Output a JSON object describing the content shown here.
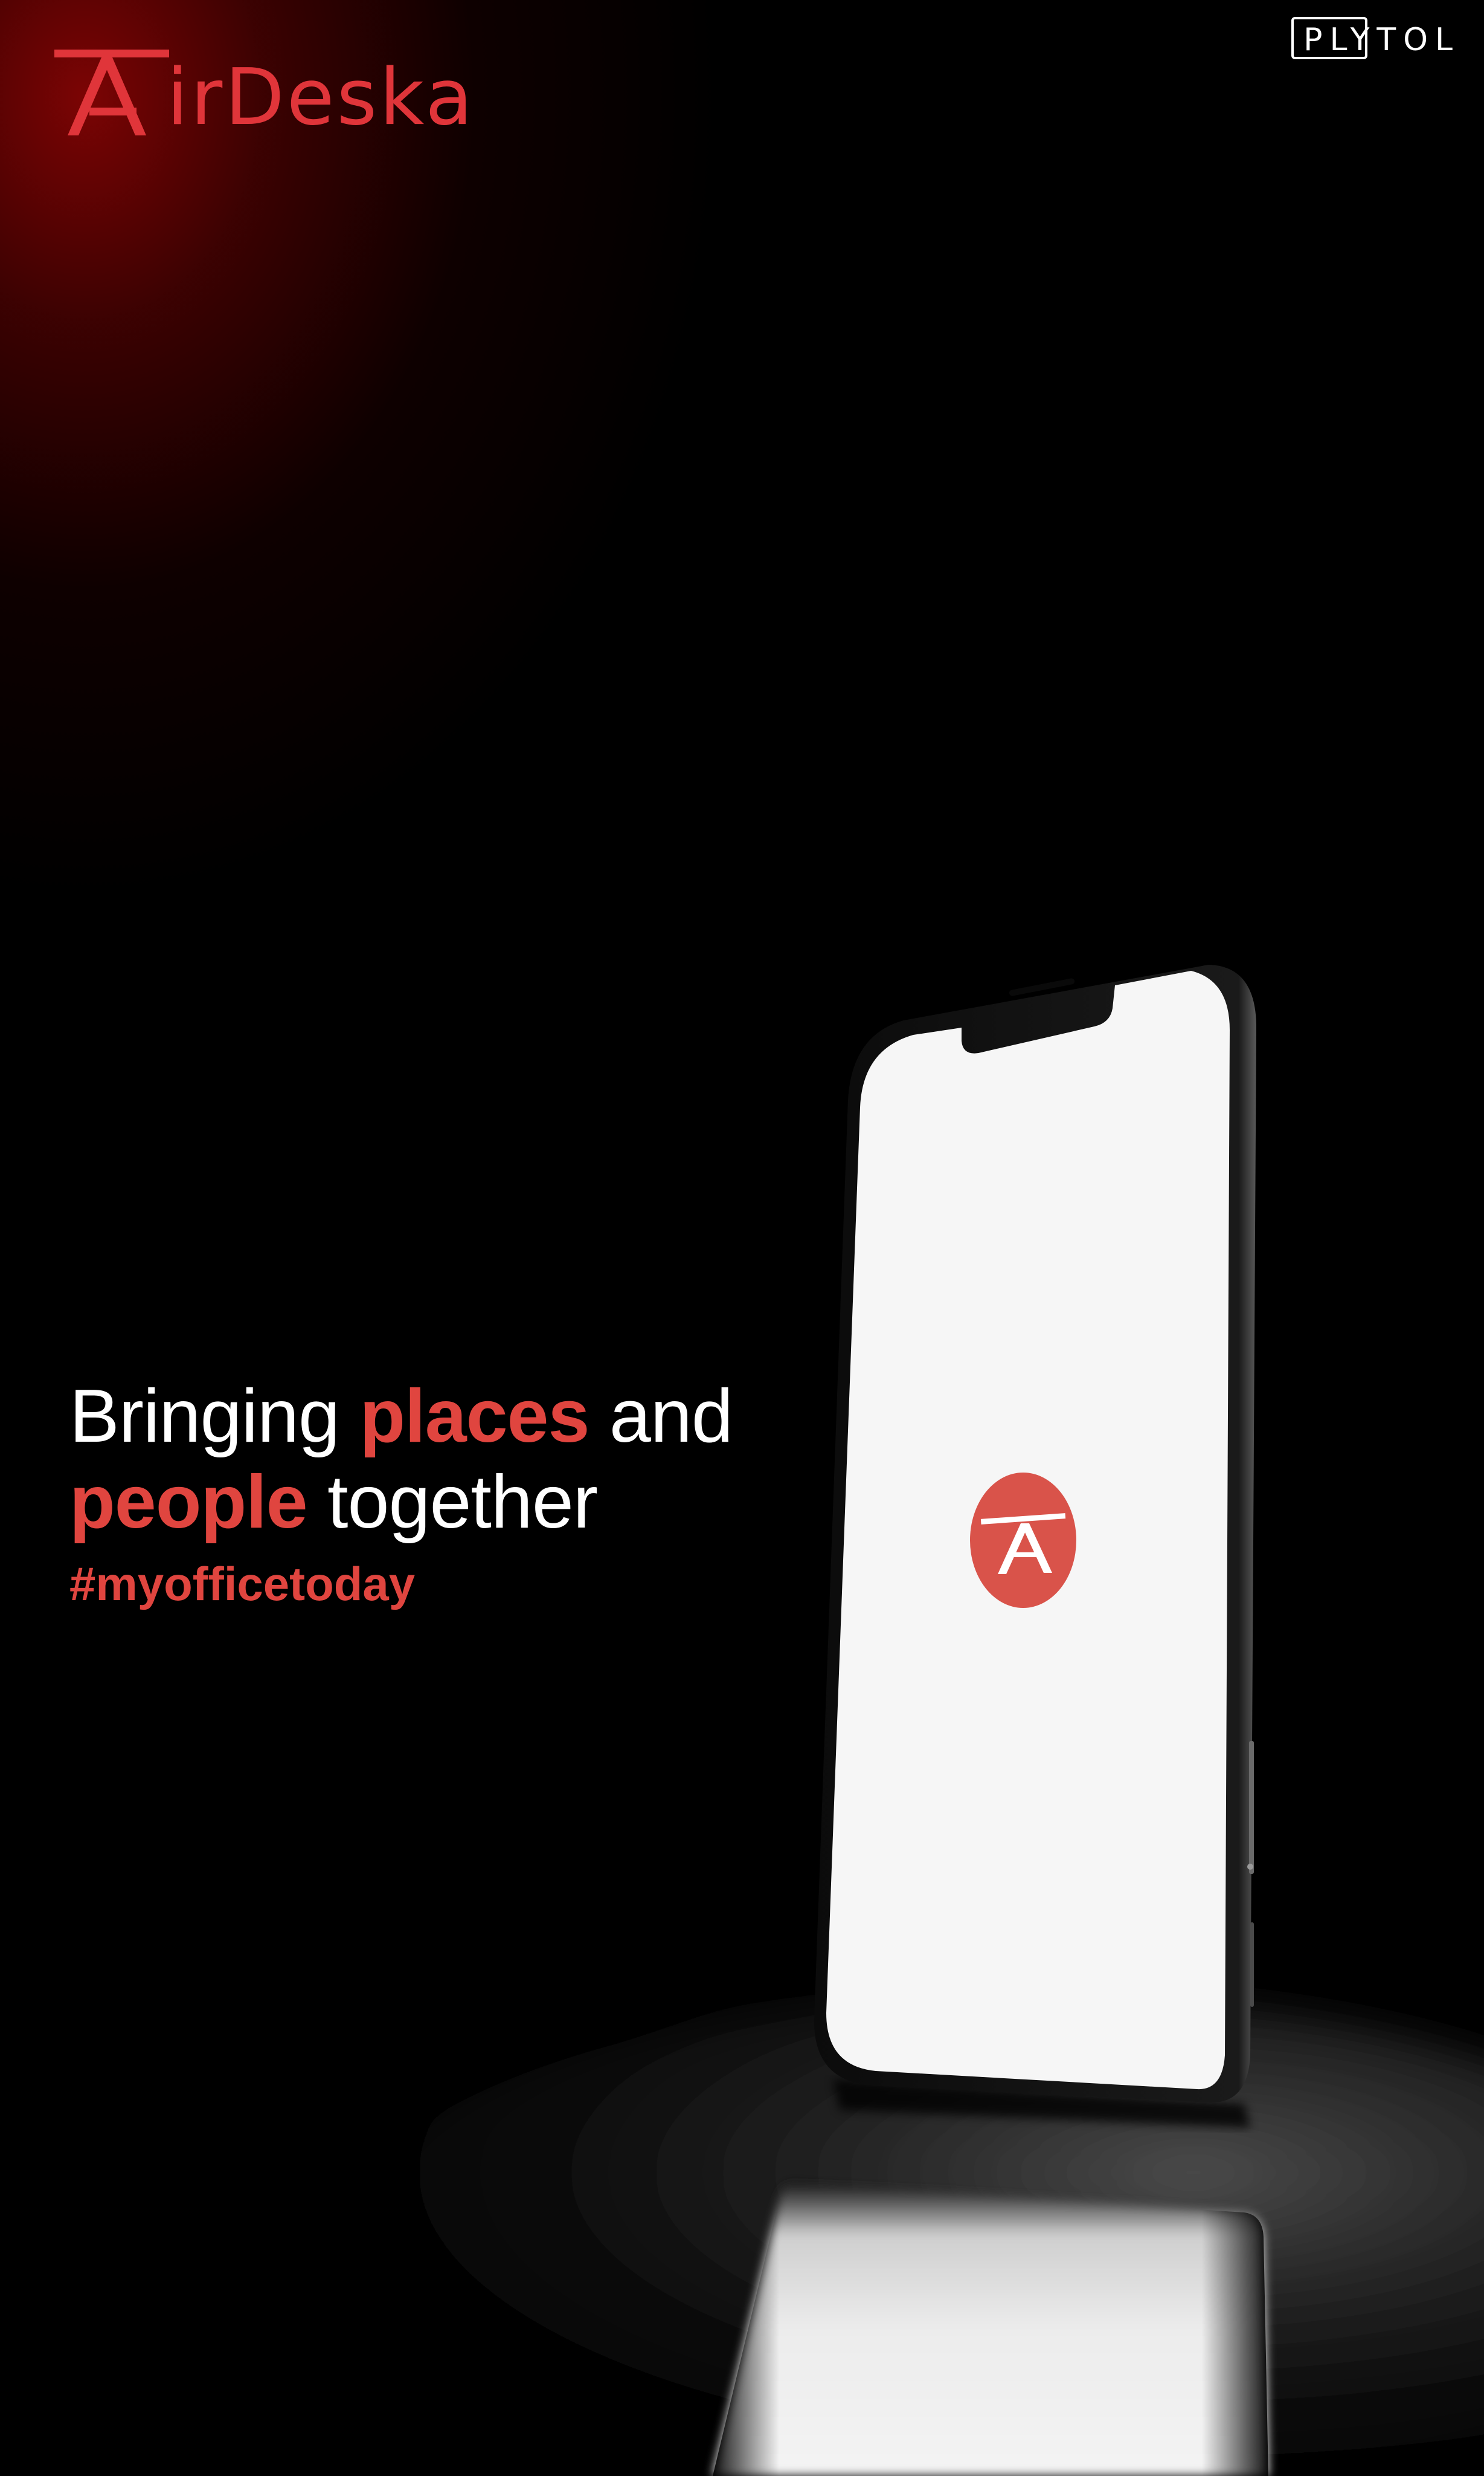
{
  "brand": {
    "name": "AirDeska",
    "name_rest": "irDeska",
    "color": "#e0353a"
  },
  "badge": {
    "text": "PLYTOL",
    "color": "#ffffff"
  },
  "tagline": {
    "line1_prefix": "Bringing ",
    "line1_highlight": "places",
    "line1_suffix": " and",
    "line2_highlight": "people",
    "line2_suffix": " together",
    "hashtag": "#myofficetoday",
    "highlight_color": "#e0453f"
  },
  "phone": {
    "screen_color": "#f6f6f6",
    "app_icon": "airdeska-a-icon",
    "app_icon_color": "#d9534a"
  },
  "icons": {
    "brand_mark": "airdeska-logo-icon",
    "app_logo": "airdeska-a-icon"
  }
}
